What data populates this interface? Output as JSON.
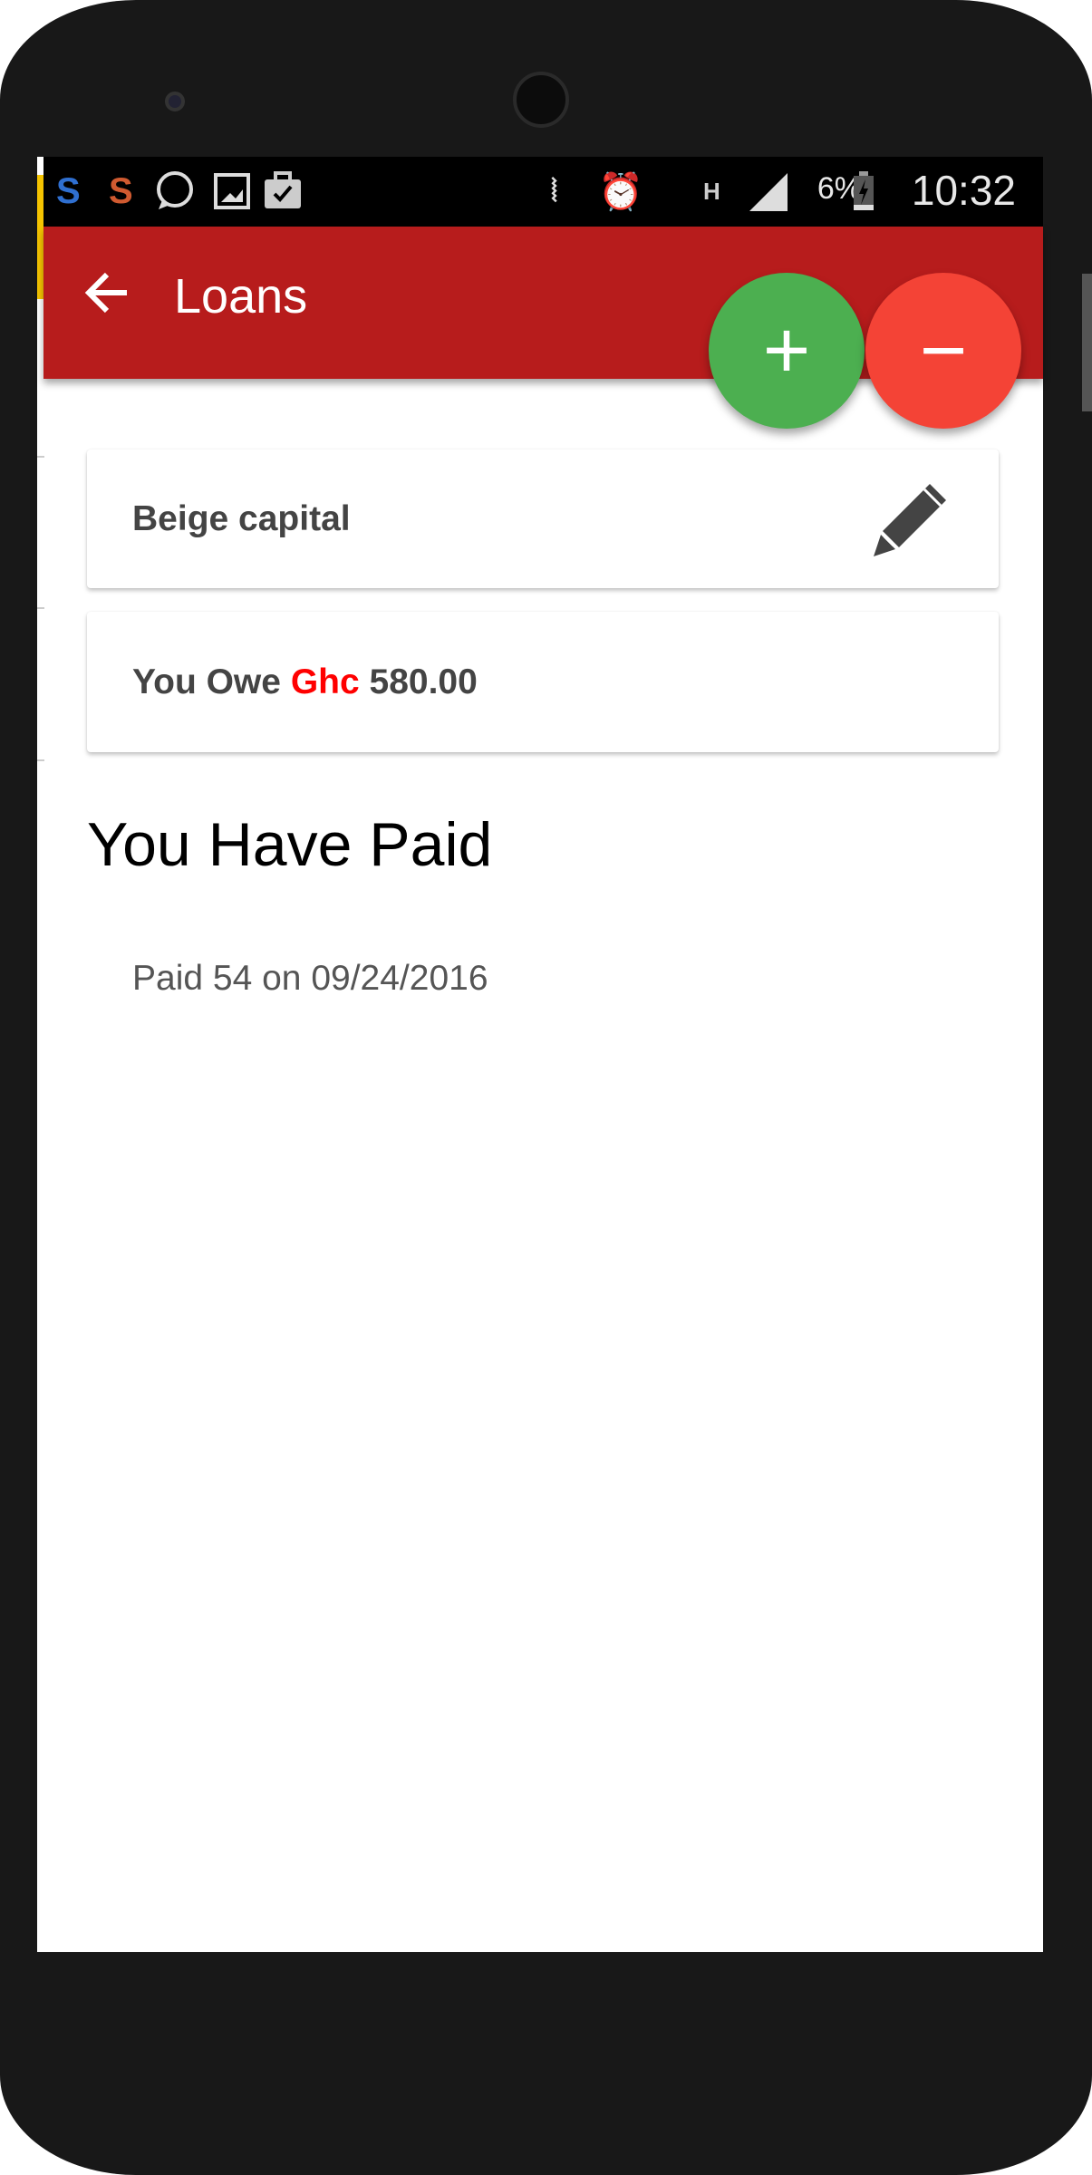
{
  "status_bar": {
    "left_icons": [
      "s-app-blue-icon",
      "s-app-orange-icon",
      "whatsapp-icon",
      "gallery-icon",
      "briefcase-check-icon"
    ],
    "right_icons": [
      "vibrate-mute-icon",
      "alarm-icon",
      "h-data-icon",
      "signal-icon",
      "battery-charging-icon"
    ],
    "network": "H",
    "battery": "6%",
    "time": "10:32"
  },
  "toolbar": {
    "title": "Loans"
  },
  "fabs": {
    "add": "+",
    "remove": "−"
  },
  "loan": {
    "name": "Beige capital",
    "owe_prefix": "You Owe",
    "currency": "Ghc",
    "amount": "580.00"
  },
  "payments": {
    "heading": "You Have Paid",
    "items": [
      "Paid 54 on 09/24/2016"
    ]
  },
  "colors": {
    "toolbar": "#b71c1c",
    "add": "#4caf50",
    "remove": "#f44336",
    "currency": "#ff0000"
  }
}
